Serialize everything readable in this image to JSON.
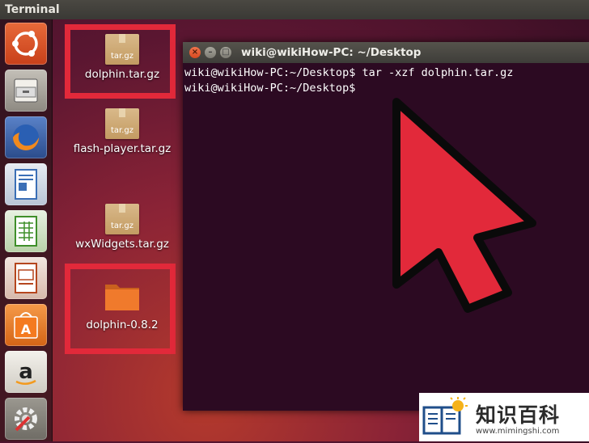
{
  "topbar": {
    "title": "Terminal"
  },
  "launcher": {
    "items": [
      {
        "name": "ubuntu-dash-icon"
      },
      {
        "name": "files-icon"
      },
      {
        "name": "firefox-icon"
      },
      {
        "name": "writer-icon"
      },
      {
        "name": "calc-icon"
      },
      {
        "name": "impress-icon"
      },
      {
        "name": "software-center-icon"
      },
      {
        "name": "amazon-icon"
      },
      {
        "name": "system-settings-icon"
      }
    ]
  },
  "desktop": {
    "items": [
      {
        "label": "dolphin.tar.gz",
        "tag": "tar.gz",
        "type": "archive"
      },
      {
        "label": "flash-player.tar.gz",
        "tag": "tar.gz",
        "type": "archive"
      },
      {
        "label": "wxWidgets.tar.gz",
        "tag": "tar.gz",
        "type": "archive"
      },
      {
        "label": "dolphin-0.8.2",
        "type": "folder"
      }
    ]
  },
  "terminal": {
    "title": "wiki@wikiHow-PC: ~/Desktop",
    "lines": [
      "wiki@wikiHow-PC:~/Desktop$ tar -xzf dolphin.tar.gz",
      "wiki@wikiHow-PC:~/Desktop$"
    ]
  },
  "watermark": {
    "title": "知识百科",
    "url": "www.mimingshi.com"
  },
  "colors": {
    "highlight": "#e2293a",
    "terminal_bg": "#2c0a22",
    "pointer": "#e2293a"
  }
}
